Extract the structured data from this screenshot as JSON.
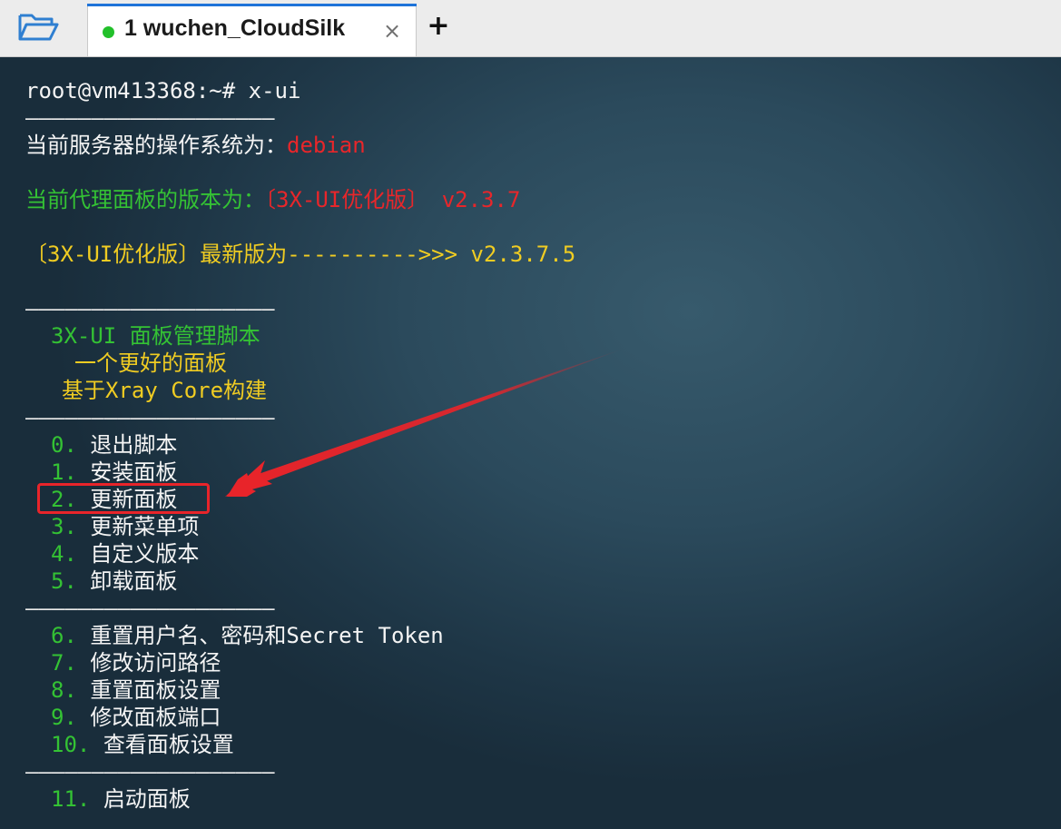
{
  "tabbar": {
    "folder_icon": "folder-open-icon",
    "tab": {
      "index": "1",
      "title": "wuchen_CloudSilk",
      "status_color": "#22c02a",
      "close_glyph": "×"
    },
    "new_tab_glyph": "+"
  },
  "terminal": {
    "prompt": "root@vm413368:~# x-ui",
    "separator": "———————————————————",
    "os_label": "当前服务器的操作系统为：",
    "os_value": "debian",
    "panel_version_label": "当前代理面板的版本为：",
    "panel_version_value": "〔3X-UI优化版〕 v2.3.7",
    "latest_label": "〔3X-UI优化版〕最新版为---------->>>",
    "latest_value": " v2.3.7.5",
    "header": {
      "title": "3X-UI 面板管理脚本",
      "subtitle": "一个更好的面板",
      "tagline": "基于Xray Core构建"
    },
    "menu_group1": [
      {
        "num": "0.",
        "label": "退出脚本"
      },
      {
        "num": "1.",
        "label": "安装面板"
      },
      {
        "num": "2.",
        "label": "更新面板"
      },
      {
        "num": "3.",
        "label": "更新菜单项"
      },
      {
        "num": "4.",
        "label": "自定义版本"
      },
      {
        "num": "5.",
        "label": "卸载面板"
      }
    ],
    "menu_group2": [
      {
        "num": "6.",
        "label": "重置用户名、密码和Secret Token"
      },
      {
        "num": "7.",
        "label": "修改访问路径"
      },
      {
        "num": "8.",
        "label": "重置面板设置"
      },
      {
        "num": "9.",
        "label": "修改面板端口"
      },
      {
        "num": "10.",
        "label": "查看面板设置"
      }
    ],
    "menu_group3": [
      {
        "num": "11.",
        "label": "启动面板"
      }
    ],
    "annotation": {
      "color": "#e8242a",
      "arrow_icon": "red-arrow-icon"
    }
  }
}
